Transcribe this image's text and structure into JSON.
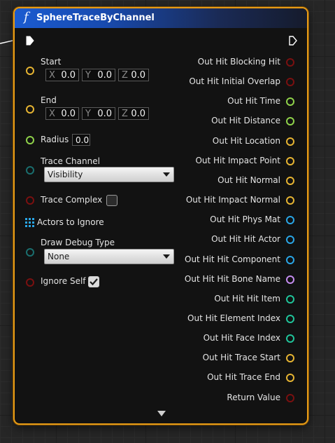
{
  "node": {
    "title": "SphereTraceByChannel",
    "function_icon": "f"
  },
  "inputs": {
    "start": {
      "label": "Start",
      "x": "0.0",
      "y": "0.0",
      "z": "0.0"
    },
    "end": {
      "label": "End",
      "x": "0.0",
      "y": "0.0",
      "z": "0.0"
    },
    "radius": {
      "label": "Radius",
      "value": "0.0"
    },
    "trace_channel": {
      "label": "Trace Channel",
      "selected": "Visibility"
    },
    "trace_complex": {
      "label": "Trace Complex",
      "checked": false
    },
    "actors_to_ignore": {
      "label": "Actors to Ignore"
    },
    "draw_debug_type": {
      "label": "Draw Debug Type",
      "selected": "None"
    },
    "ignore_self": {
      "label": "Ignore Self",
      "checked": true
    },
    "axis_labels": {
      "x": "X",
      "y": "Y",
      "z": "Z"
    }
  },
  "outputs": [
    {
      "label": "Out Hit Blocking Hit",
      "pin_color": "#7a1010"
    },
    {
      "label": "Out Hit Initial Overlap",
      "pin_color": "#7a1010"
    },
    {
      "label": "Out Hit Time",
      "pin_color": "#8fd24a"
    },
    {
      "label": "Out Hit Distance",
      "pin_color": "#8fd24a"
    },
    {
      "label": "Out Hit Location",
      "pin_color": "#e6b432"
    },
    {
      "label": "Out Hit Impact Point",
      "pin_color": "#e6b432"
    },
    {
      "label": "Out Hit Normal",
      "pin_color": "#e6b432"
    },
    {
      "label": "Out Hit Impact Normal",
      "pin_color": "#e6b432"
    },
    {
      "label": "Out Hit Phys Mat",
      "pin_color": "#2aa6e6"
    },
    {
      "label": "Out Hit Hit Actor",
      "pin_color": "#2aa6e6"
    },
    {
      "label": "Out Hit Hit Component",
      "pin_color": "#2aa6e6"
    },
    {
      "label": "Out Hit Hit Bone Name",
      "pin_color": "#c48cf0"
    },
    {
      "label": "Out Hit Hit Item",
      "pin_color": "#20c49a"
    },
    {
      "label": "Out Hit Element Index",
      "pin_color": "#20c49a"
    },
    {
      "label": "Out Hit Face Index",
      "pin_color": "#20c49a"
    },
    {
      "label": "Out Hit Trace Start",
      "pin_color": "#e6b432"
    },
    {
      "label": "Out Hit Trace End",
      "pin_color": "#e6b432"
    },
    {
      "label": "Return Value",
      "pin_color": "#7a1010"
    }
  ],
  "colors": {
    "node_border": "#e69b17",
    "header_accent": "#1a5bd0",
    "vector_pin": "#e6b432",
    "float_pin": "#8fd24a",
    "byte_pin": "#1a6e6e",
    "bool_pin": "#7a1010",
    "object_pin": "#2aa6e6"
  },
  "icons": {
    "exec_in": "exec-arrow-filled",
    "exec_out": "exec-arrow-outline",
    "array": "array-grid-icon",
    "expand": "chevron-down-icon"
  }
}
